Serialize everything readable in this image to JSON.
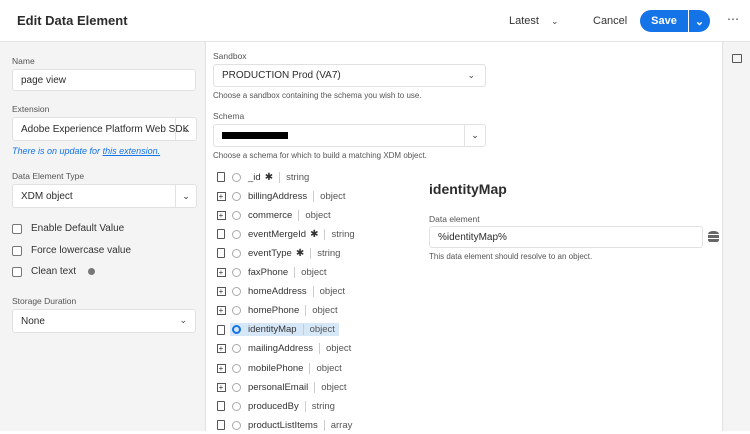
{
  "header": {
    "title": "Edit Data Element",
    "version": "Latest",
    "cancel": "Cancel",
    "save": "Save"
  },
  "left": {
    "name_label": "Name",
    "name_value": "page view",
    "extension_label": "Extension",
    "extension_value": "Adobe Experience Platform Web SDK",
    "update_text": "There is on update for ",
    "update_link": "this extension.",
    "type_label": "Data Element Type",
    "type_value": "XDM object",
    "checkboxes": [
      {
        "label": "Enable Default Value",
        "checked": false
      },
      {
        "label": "Force lowercase value",
        "checked": false
      },
      {
        "label": "Clean text",
        "checked": false
      }
    ],
    "storage_label": "Storage Duration",
    "storage_value": "None"
  },
  "main": {
    "sandbox_label": "Sandbox",
    "sandbox_value": "PRODUCTION Prod (VA7)",
    "sandbox_help": "Choose a sandbox containing the schema you wish to use.",
    "schema_label": "Schema",
    "schema_help": "Choose a schema for which to build a matching XDM object.",
    "tree": [
      {
        "name": "_id",
        "type": "string",
        "required": true,
        "expandable": false
      },
      {
        "name": "billingAddress",
        "type": "object",
        "required": false,
        "expandable": true
      },
      {
        "name": "commerce",
        "type": "object",
        "required": false,
        "expandable": true
      },
      {
        "name": "eventMergeId",
        "type": "string",
        "required": true,
        "expandable": false
      },
      {
        "name": "eventType",
        "type": "string",
        "required": true,
        "expandable": false
      },
      {
        "name": "faxPhone",
        "type": "object",
        "required": false,
        "expandable": true
      },
      {
        "name": "homeAddress",
        "type": "object",
        "required": false,
        "expandable": true
      },
      {
        "name": "homePhone",
        "type": "object",
        "required": false,
        "expandable": true
      },
      {
        "name": "identityMap",
        "type": "object",
        "required": false,
        "expandable": false,
        "selected": true
      },
      {
        "name": "mailingAddress",
        "type": "object",
        "required": false,
        "expandable": true
      },
      {
        "name": "mobilePhone",
        "type": "object",
        "required": false,
        "expandable": true
      },
      {
        "name": "personalEmail",
        "type": "object",
        "required": false,
        "expandable": true
      },
      {
        "name": "producedBy",
        "type": "string",
        "required": false,
        "expandable": false
      },
      {
        "name": "productListItems",
        "type": "array",
        "required": false,
        "expandable": false
      }
    ],
    "detail_title": "identityMap",
    "detail_label": "Data element",
    "detail_value": "%identityMap%",
    "detail_help": "This data element should resolve to an object."
  }
}
